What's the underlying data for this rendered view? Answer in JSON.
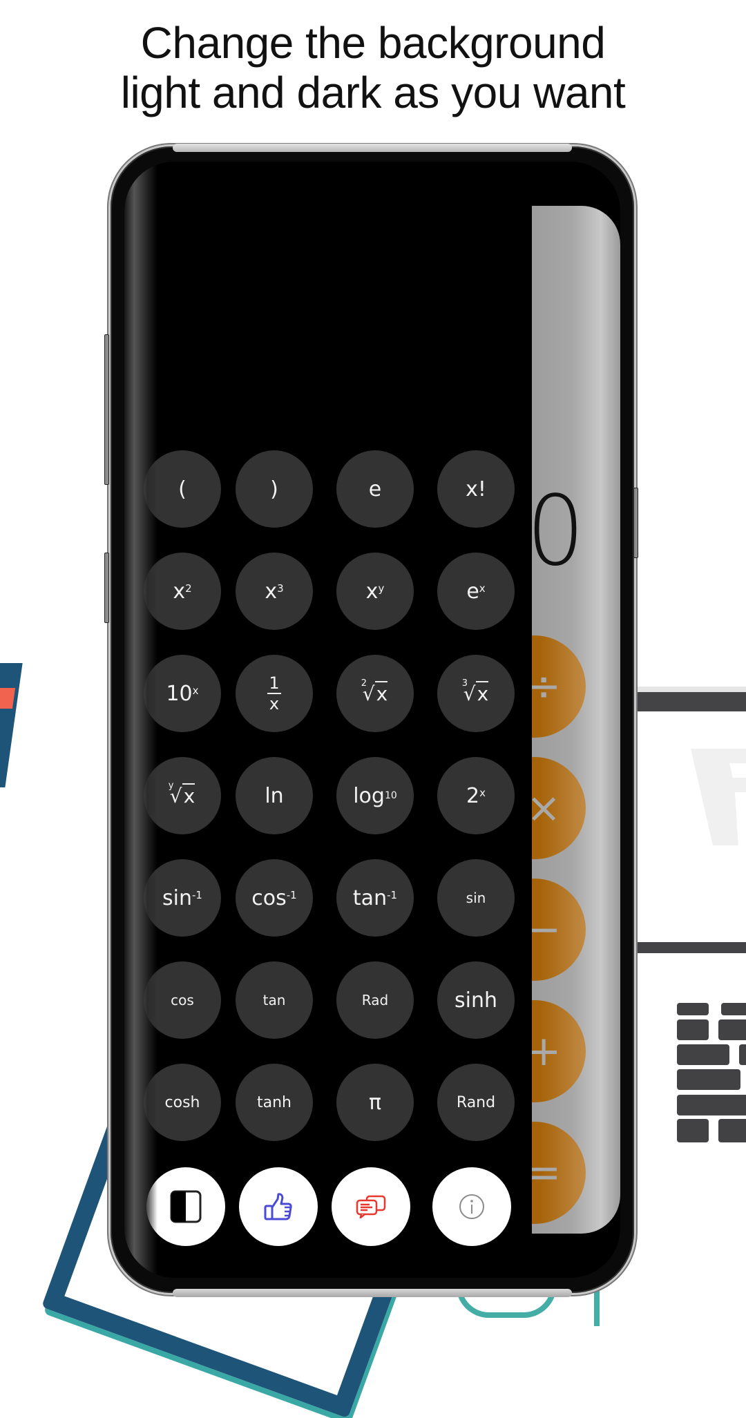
{
  "headline": {
    "line1": "Change the background",
    "line2": "light and dark as you want"
  },
  "calculator": {
    "theme": "dark",
    "display_value": "0",
    "function_keys": [
      [
        {
          "id": "open-paren",
          "label": "("
        },
        {
          "id": "close-paren",
          "label": ")"
        },
        {
          "id": "e",
          "label": "e"
        },
        {
          "id": "factorial",
          "label": "x!"
        }
      ],
      [
        {
          "id": "x-squared",
          "base": "x",
          "sup": "2"
        },
        {
          "id": "x-cubed",
          "base": "x",
          "sup": "3"
        },
        {
          "id": "x-power-y",
          "base": "x",
          "sup": "y"
        },
        {
          "id": "e-power-x",
          "base": "e",
          "sup": "x"
        }
      ],
      [
        {
          "id": "ten-power-x",
          "base": "10",
          "sup": "x"
        },
        {
          "id": "reciprocal",
          "num": "1",
          "den": "x"
        },
        {
          "id": "square-root",
          "index": "2",
          "radicand": "x"
        },
        {
          "id": "cube-root",
          "index": "3",
          "radicand": "x"
        }
      ],
      [
        {
          "id": "y-root",
          "index": "y",
          "radicand": "x"
        },
        {
          "id": "ln",
          "label": "ln"
        },
        {
          "id": "log10",
          "base": "log",
          "sub": "10"
        },
        {
          "id": "two-power-x",
          "base": "2",
          "sup": "x"
        }
      ],
      [
        {
          "id": "arcsin",
          "base": "sin",
          "sup": "-1"
        },
        {
          "id": "arccos",
          "base": "cos",
          "sup": "-1"
        },
        {
          "id": "arctan",
          "base": "tan",
          "sup": "-1"
        },
        {
          "id": "sin",
          "label": "sin"
        }
      ],
      [
        {
          "id": "cos",
          "label": "cos"
        },
        {
          "id": "tan",
          "label": "tan"
        },
        {
          "id": "rad",
          "label": "Rad"
        },
        {
          "id": "sinh",
          "label": "sinh"
        }
      ],
      [
        {
          "id": "cosh",
          "label": "cosh"
        },
        {
          "id": "tanh",
          "label": "tanh"
        },
        {
          "id": "pi",
          "label": "π"
        },
        {
          "id": "rand",
          "label": "Rand"
        }
      ]
    ],
    "utility_buttons": [
      {
        "id": "theme-toggle",
        "icon": "theme-toggle-icon"
      },
      {
        "id": "rate",
        "icon": "thumbs-up-icon"
      },
      {
        "id": "feedback",
        "icon": "chat-bubbles-icon"
      },
      {
        "id": "info",
        "icon": "info-icon"
      }
    ],
    "operators": [
      {
        "id": "divide",
        "label": "÷"
      },
      {
        "id": "multiply",
        "label": "×"
      },
      {
        "id": "subtract",
        "label": "−"
      },
      {
        "id": "add",
        "label": "+"
      },
      {
        "id": "equals",
        "label": "="
      }
    ]
  },
  "colors": {
    "background": "#ffffff",
    "key_dark": "#333333",
    "key_text": "#f2f2f2",
    "operator": "#a66309",
    "operator_symbol": "#a9a9a9",
    "light_panel": "#a6a6a6",
    "thumbs_up": "#4a4ad6",
    "feedback": "#e8372c",
    "info": "#8a8a8a"
  }
}
